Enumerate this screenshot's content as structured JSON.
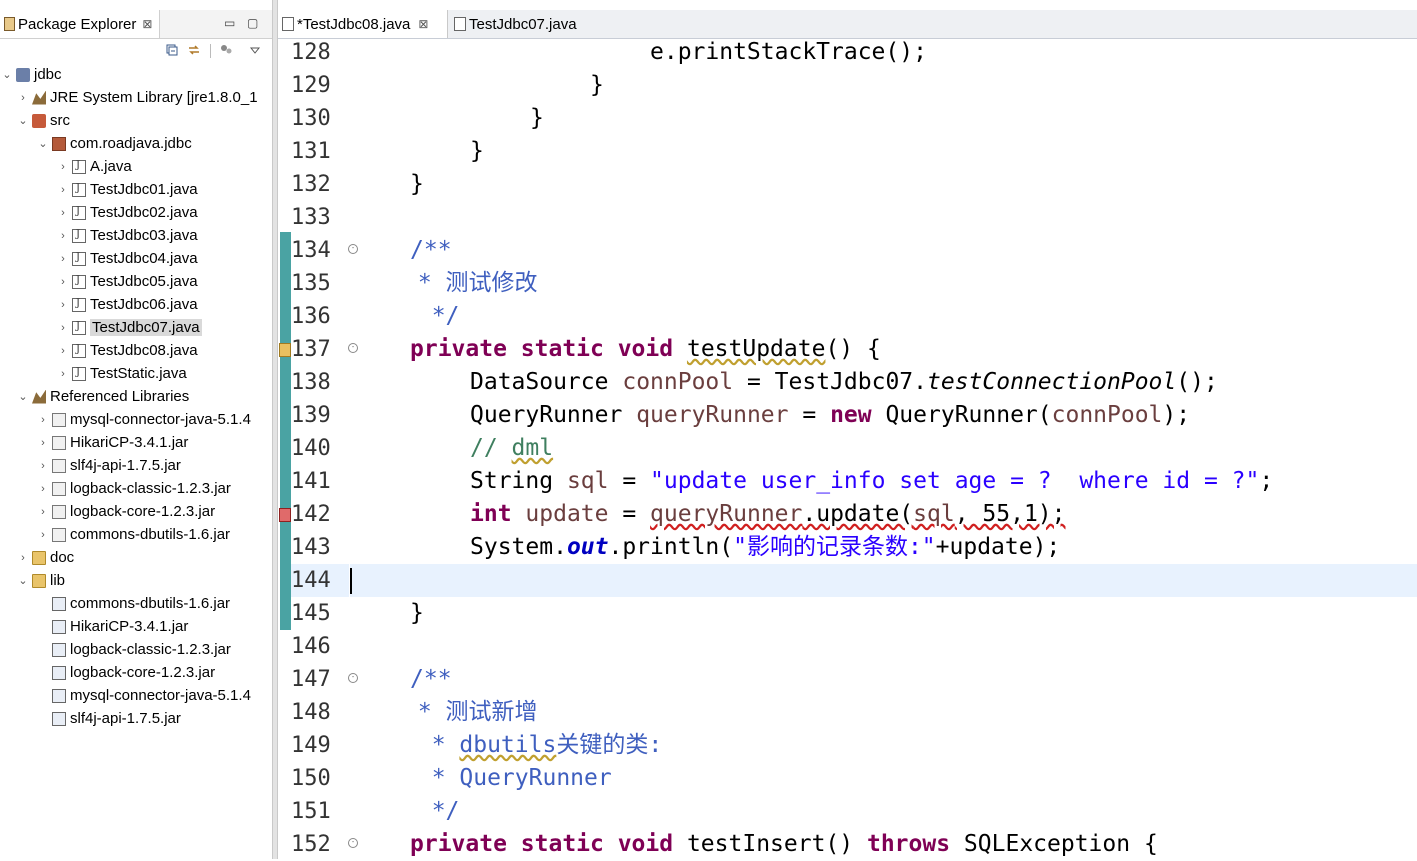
{
  "explorer": {
    "tab_label": "Package Explorer",
    "close_glyph": "⊠",
    "minimize_glyph": "▭",
    "maximize_glyph": "▢",
    "tree": [
      {
        "label": "jdbc",
        "twisty": "⌄",
        "icon": "project-icon"
      },
      {
        "label": "JRE System Library [jre1.8.0_1",
        "twisty": "›",
        "icon": "library-icon"
      },
      {
        "label": "src",
        "twisty": "⌄",
        "icon": "source-folder-icon"
      },
      {
        "label": "com.roadjava.jdbc",
        "twisty": "⌄",
        "icon": "package-icon"
      },
      {
        "label": "A.java",
        "twisty": "›",
        "icon": "java-file-icon"
      },
      {
        "label": "TestJdbc01.java",
        "twisty": "›",
        "icon": "java-file-icon"
      },
      {
        "label": "TestJdbc02.java",
        "twisty": "›",
        "icon": "java-file-icon"
      },
      {
        "label": "TestJdbc03.java",
        "twisty": "›",
        "icon": "java-file-icon"
      },
      {
        "label": "TestJdbc04.java",
        "twisty": "›",
        "icon": "java-file-icon"
      },
      {
        "label": "TestJdbc05.java",
        "twisty": "›",
        "icon": "java-file-icon"
      },
      {
        "label": "TestJdbc06.java",
        "twisty": "›",
        "icon": "java-file-icon"
      },
      {
        "label": "TestJdbc07.java",
        "twisty": "›",
        "icon": "java-file-icon",
        "selected": true
      },
      {
        "label": "TestJdbc08.java",
        "twisty": "›",
        "icon": "java-file-icon"
      },
      {
        "label": "TestStatic.java",
        "twisty": "›",
        "icon": "java-file-icon"
      },
      {
        "label": "Referenced Libraries",
        "twisty": "⌄",
        "icon": "library-icon"
      },
      {
        "label": "mysql-connector-java-5.1.4",
        "twisty": "›",
        "icon": "jar-icon"
      },
      {
        "label": "HikariCP-3.4.1.jar",
        "twisty": "›",
        "icon": "jar-icon"
      },
      {
        "label": "slf4j-api-1.7.5.jar",
        "twisty": "›",
        "icon": "jar-icon"
      },
      {
        "label": "logback-classic-1.2.3.jar",
        "twisty": "›",
        "icon": "jar-icon"
      },
      {
        "label": "logback-core-1.2.3.jar",
        "twisty": "›",
        "icon": "jar-icon"
      },
      {
        "label": "commons-dbutils-1.6.jar",
        "twisty": "›",
        "icon": "jar-icon"
      },
      {
        "label": "doc",
        "twisty": "›",
        "icon": "folder-icon"
      },
      {
        "label": "lib",
        "twisty": "⌄",
        "icon": "folder-icon"
      },
      {
        "label": "commons-dbutils-1.6.jar",
        "twisty": "",
        "icon": "jar-file-icon"
      },
      {
        "label": "HikariCP-3.4.1.jar",
        "twisty": "",
        "icon": "jar-file-icon"
      },
      {
        "label": "logback-classic-1.2.3.jar",
        "twisty": "",
        "icon": "jar-file-icon"
      },
      {
        "label": "logback-core-1.2.3.jar",
        "twisty": "",
        "icon": "jar-file-icon"
      },
      {
        "label": "mysql-connector-java-5.1.4",
        "twisty": "",
        "icon": "jar-file-icon"
      },
      {
        "label": "slf4j-api-1.7.5.jar",
        "twisty": "",
        "icon": "jar-file-icon"
      }
    ]
  },
  "editor": {
    "tabs": [
      {
        "label": "*TestJdbc08.java",
        "active": true
      },
      {
        "label": "TestJdbc07.java",
        "active": false
      }
    ],
    "tab_close_glyph": "⊠",
    "line_numbers": [
      "128",
      "129",
      "130",
      "131",
      "132",
      "133",
      "134",
      "135",
      "136",
      "137",
      "138",
      "139",
      "140",
      "141",
      "142",
      "143",
      "144",
      "145",
      "146",
      "147",
      "148",
      "149",
      "150",
      "151",
      "152"
    ],
    "current_line": "144",
    "code": {
      "l128": "e.printStackTrace();",
      "l129": "}",
      "l130": "}",
      "l131": "}",
      "l132": "}",
      "l134": "/**",
      "l135": " * 测试修改",
      "l136": "  */",
      "l137_kw": "private static void",
      "l137_name": "testUpdate",
      "l137_rest": "() {",
      "l138_type": "DataSource",
      "l138_var": "connPool",
      "l138_eq": " = TestJdbc07.",
      "l138_call": "testConnectionPool",
      "l138_end": "();",
      "l139_type": "QueryRunner",
      "l139_var": "queryRunner",
      "l139_eq": " = ",
      "l139_new": "new",
      "l139_ctor": " QueryRunner(",
      "l139_arg": "connPool",
      "l139_end": ");",
      "l140_slash": "// ",
      "l140_word": "dml",
      "l141_type": "String",
      "l141_var": "sql",
      "l141_eq": " = ",
      "l141_str1": "\"update user_info set ",
      "l141_age": "age",
      "l141_str2": " = ?  where id = ?\"",
      "l141_end": ";",
      "l142_kw": "int",
      "l142_var": "update",
      "l142_eq": " = ",
      "l142_recv": "queryRunner",
      "l142_dot": ".update(",
      "l142_arg": "sql",
      "l142_end": ", 55,1);",
      "l143_a": "System.",
      "l143_out": "out",
      "l143_b": ".println(",
      "l143_str": "\"影响的记录条数:\"",
      "l143_c": "+update);",
      "l145": "}",
      "l147": "/**",
      "l148": " * 测试新增",
      "l149_star": "  * ",
      "l149_word": "dbutils",
      "l149_rest": "关键的类:",
      "l150": "  * QueryRunner",
      "l151": "  */",
      "l152_kw": "private static void",
      "l152_name": " testInsert() ",
      "l152_throws": "throws",
      "l152_rest": " SQLException {"
    }
  },
  "colors": {
    "keyword": "#7f0055",
    "javadoc": "#3f5fbf",
    "comment": "#3f7f5f",
    "string": "#2a00ff",
    "static_field": "#0000c0",
    "change_ruler": "#4aa3a3",
    "current_line": "#e8f2fe"
  }
}
